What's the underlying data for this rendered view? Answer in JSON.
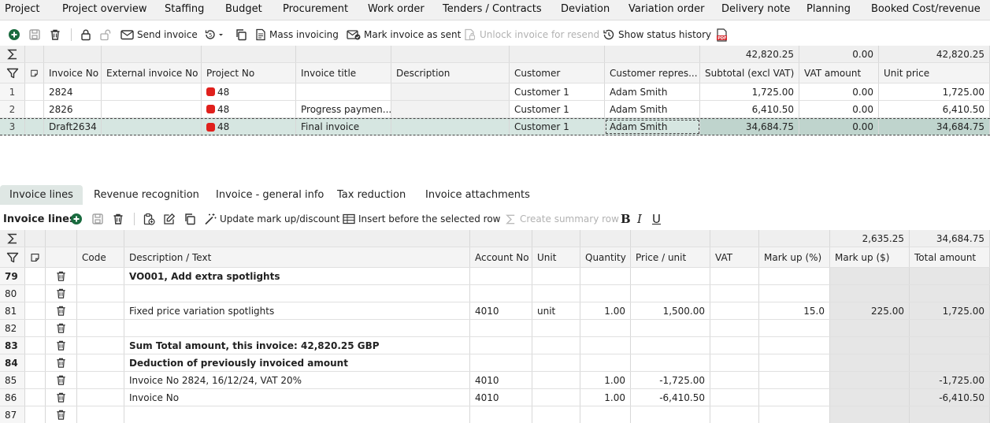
{
  "menu": [
    "Project",
    "Project overview",
    "Staffing",
    "Budget",
    "Procurement",
    "Work order",
    "Tenders / Contracts",
    "Deviation",
    "Variation order",
    "Delivery note",
    "Planning",
    "Booked Cost/revenue"
  ],
  "toolbar": {
    "send_invoice": "Send invoice",
    "mass_invoicing": "Mass invoicing",
    "mark_sent": "Mark invoice as sent",
    "unlock": "Unlock invoice for resend",
    "status_history": "Show status history"
  },
  "invoices": {
    "sums": {
      "subtotal": "42,820.25",
      "vat": "0.00",
      "unit_price": "42,820.25"
    },
    "columns": [
      "Invoice No",
      "External invoice No",
      "Project No",
      "Invoice title",
      "Description",
      "Customer",
      "Customer repres...",
      "Subtotal (excl VAT)",
      "VAT amount",
      "Unit price"
    ],
    "rows": [
      {
        "n": "1",
        "invoice_no": "2824",
        "ext": "",
        "project": "48",
        "title": "",
        "desc": "",
        "customer": "Customer 1",
        "rep": "Adam Smith",
        "subtotal": "1,725.00",
        "vat": "0.00",
        "unit": "1,725.00"
      },
      {
        "n": "2",
        "invoice_no": "2826",
        "ext": "",
        "project": "48",
        "title": "Progress paymen...",
        "desc": "",
        "customer": "Customer 1",
        "rep": "Adam Smith",
        "subtotal": "6,410.50",
        "vat": "0.00",
        "unit": "6,410.50"
      },
      {
        "n": "3",
        "invoice_no": "Draft2634",
        "ext": "",
        "project": "48",
        "title": "Final invoice",
        "desc": "",
        "customer": "Customer 1",
        "rep": "Adam Smith",
        "subtotal": "34,684.75",
        "vat": "0.00",
        "unit": "34,684.75"
      }
    ],
    "status_color": "#e0201c",
    "selected_color": "#d6e6e1"
  },
  "tabs": [
    "Invoice lines",
    "Revenue recognition",
    "Invoice - general info",
    "Tax reduction",
    "Invoice attachments"
  ],
  "lines_toolbar": {
    "title": "Invoice lines",
    "update_markup": "Update mark up/discount",
    "insert_before": "Insert before the selected row",
    "create_summary": "Create summary row"
  },
  "lines": {
    "sums": {
      "markup_amount": "2,635.25",
      "total": "34,684.75"
    },
    "columns": [
      "Code",
      "Description / Text",
      "Account No",
      "Unit",
      "Quantity",
      "Price / unit",
      "VAT",
      "Mark up (%)",
      "Mark up ($)",
      "Total amount"
    ],
    "rows": [
      {
        "n": "79",
        "bold": true,
        "desc": "VO001, Add extra spotlights",
        "acc": "",
        "unit": "",
        "qty": "",
        "price": "",
        "vat": "",
        "mu_pct": "",
        "mu_amt": "",
        "total": ""
      },
      {
        "n": "80",
        "bold": false,
        "desc": "",
        "acc": "",
        "unit": "",
        "qty": "",
        "price": "",
        "vat": "",
        "mu_pct": "",
        "mu_amt": "",
        "total": ""
      },
      {
        "n": "81",
        "bold": false,
        "desc": "Fixed price variation spotlights",
        "acc": "4010",
        "unit": "unit",
        "qty": "1.00",
        "price": "1,500.00",
        "vat": "",
        "mu_pct": "15.0",
        "mu_amt": "225.00",
        "total": "1,725.00"
      },
      {
        "n": "82",
        "bold": false,
        "desc": "",
        "acc": "",
        "unit": "",
        "qty": "",
        "price": "",
        "vat": "",
        "mu_pct": "",
        "mu_amt": "",
        "total": ""
      },
      {
        "n": "83",
        "bold": true,
        "desc": "Sum Total amount, this invoice: 42,820.25 GBP",
        "acc": "",
        "unit": "",
        "qty": "",
        "price": "",
        "vat": "",
        "mu_pct": "",
        "mu_amt": "",
        "total": ""
      },
      {
        "n": "84",
        "bold": true,
        "desc": "Deduction of previously invoiced amount",
        "acc": "",
        "unit": "",
        "qty": "",
        "price": "",
        "vat": "",
        "mu_pct": "",
        "mu_amt": "",
        "total": ""
      },
      {
        "n": "85",
        "bold": false,
        "desc": "Invoice No 2824, 16/12/24, VAT 20%",
        "acc": "4010",
        "unit": "",
        "qty": "1.00",
        "price": "-1,725.00",
        "vat": "",
        "mu_pct": "",
        "mu_amt": "",
        "total": "-1,725.00"
      },
      {
        "n": "86",
        "bold": false,
        "desc": "Invoice No",
        "acc": "4010",
        "unit": "",
        "qty": "1.00",
        "price": "-6,410.50",
        "vat": "",
        "mu_pct": "",
        "mu_amt": "",
        "total": "-6,410.50"
      },
      {
        "n": "87",
        "bold": false,
        "desc": "",
        "acc": "",
        "unit": "",
        "qty": "",
        "price": "",
        "vat": "",
        "mu_pct": "",
        "mu_amt": "",
        "total": ""
      }
    ]
  },
  "icons": [
    "add-icon",
    "save-icon",
    "trash-icon",
    "lock-icon",
    "unlock-icon",
    "envelope-icon",
    "history-icon",
    "copy-icon",
    "mail-check-icon",
    "document-lock-icon",
    "clock-history-icon",
    "pdf-icon",
    "sigma-icon",
    "filter-icon",
    "note-icon",
    "clipboard-add-icon",
    "edit-icon",
    "wand-icon",
    "table-icon",
    "bold-icon",
    "italic-icon",
    "underline-icon"
  ]
}
